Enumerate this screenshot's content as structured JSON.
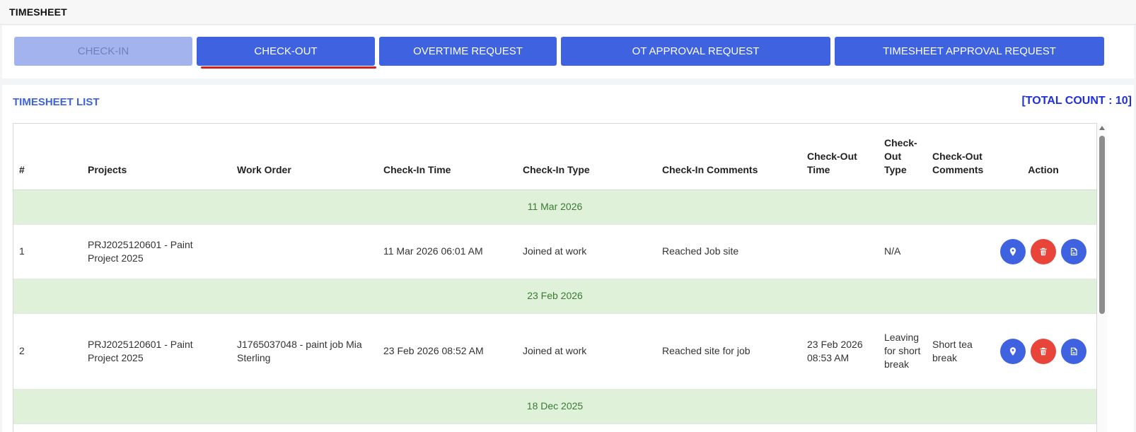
{
  "header": {
    "title": "TIMESHEET"
  },
  "toolbar": {
    "checkin_label": "CHECK-IN",
    "checkout_label": "CHECK-OUT",
    "overtime_label": "OVERTIME REQUEST",
    "ot_approval_label": "OT APPROVAL REQUEST",
    "timesheet_approval_label": "TIMESHEET APPROVAL REQUEST"
  },
  "list": {
    "title": "TIMESHEET LIST",
    "total_count": "[TOTAL COUNT : 10]",
    "columns": [
      "#",
      "Projects",
      "Work Order",
      "Check-In Time",
      "Check-In Type",
      "Check-In Comments",
      "Check-Out Time",
      "Check-Out Type",
      "Check-Out Comments",
      "Action"
    ],
    "groups": [
      {
        "date": "11 Mar 2026",
        "rows": [
          {
            "num": "1",
            "project": "PRJ2025120601 - Paint Project 2025",
            "work_order": "",
            "checkin_time": "11 Mar 2026 06:01 AM",
            "checkin_type": "Joined at work",
            "checkin_comments": "Reached Job site",
            "checkout_time": "",
            "checkout_type": "N/A",
            "checkout_comments": ""
          }
        ]
      },
      {
        "date": "23 Feb 2026",
        "rows": [
          {
            "num": "2",
            "project": "PRJ2025120601 - Paint Project 2025",
            "work_order": "J1765037048 - paint job Mia Sterling",
            "checkin_time": "23 Feb 2026 08:52 AM",
            "checkin_type": "Joined at work",
            "checkin_comments": "Reached site for job",
            "checkout_time": "23 Feb 2026 08:53 AM",
            "checkout_type": "Leaving for short break",
            "checkout_comments": "Short tea break"
          }
        ]
      },
      {
        "date": "18 Dec 2025",
        "rows": []
      }
    ]
  },
  "icons": {
    "location": "map-pin-icon",
    "delete": "trash-icon",
    "image": "image-icon"
  },
  "colors": {
    "primary": "#3f63e0",
    "danger": "#e8443a",
    "group_bg": "#e0f1da",
    "group_text": "#3a7a33",
    "count": "#1f2fdc"
  }
}
